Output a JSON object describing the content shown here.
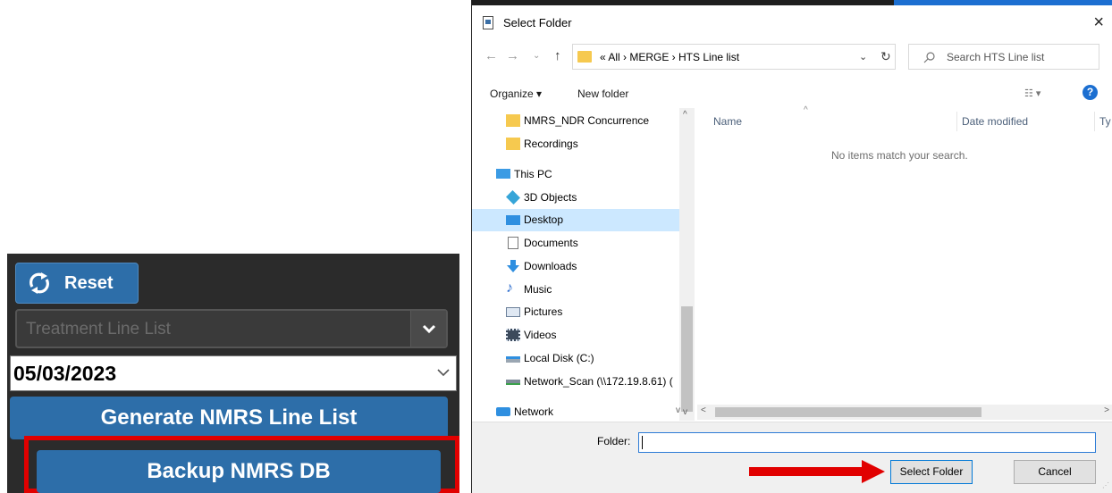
{
  "app": {
    "reset_label": "Reset",
    "treatment_placeholder": "Treatment Line List",
    "date_value": "05/03/2023",
    "generate_label": "Generate NMRS Line List",
    "backup_label": "Backup NMRS DB"
  },
  "dialog": {
    "title": "Select Folder",
    "close_symbol": "×",
    "breadcrumb": "«  All  ›  MERGE  ›  HTS Line list",
    "search_placeholder": "Search HTS Line list",
    "toolbar": {
      "organize": "Organize ▾",
      "new_folder": "New folder",
      "help": "?"
    },
    "nav_items": [
      {
        "label": "NMRS_NDR Concurrence",
        "icon": "folder-icon"
      },
      {
        "label": "Recordings",
        "icon": "folder-icon"
      },
      {
        "label": "This PC",
        "icon": "computer-icon"
      },
      {
        "label": "3D Objects",
        "icon": "cube-icon"
      },
      {
        "label": "Desktop",
        "icon": "desktop-icon",
        "selected": true
      },
      {
        "label": "Documents",
        "icon": "document-icon"
      },
      {
        "label": "Downloads",
        "icon": "download-icon"
      },
      {
        "label": "Music",
        "icon": "music-icon"
      },
      {
        "label": "Pictures",
        "icon": "pictures-icon"
      },
      {
        "label": "Videos",
        "icon": "video-icon"
      },
      {
        "label": "Local Disk (C:)",
        "icon": "drive-icon"
      },
      {
        "label": "Network_Scan (\\\\172.19.8.61) (",
        "icon": "network-drive-icon"
      },
      {
        "label": "Network",
        "icon": "network-icon"
      }
    ],
    "columns": {
      "name": "Name",
      "date_modified": "Date modified",
      "type": "Ty"
    },
    "empty_message": "No items match your search.",
    "folder_label": "Folder:",
    "folder_value": "",
    "select_button": "Select Folder",
    "cancel_button": "Cancel"
  },
  "colors": {
    "app_bg": "#2b2b2b",
    "app_button": "#2d6ea9",
    "highlight": "#e10000",
    "accent": "#1c6fd1",
    "selection": "#cce8ff"
  }
}
